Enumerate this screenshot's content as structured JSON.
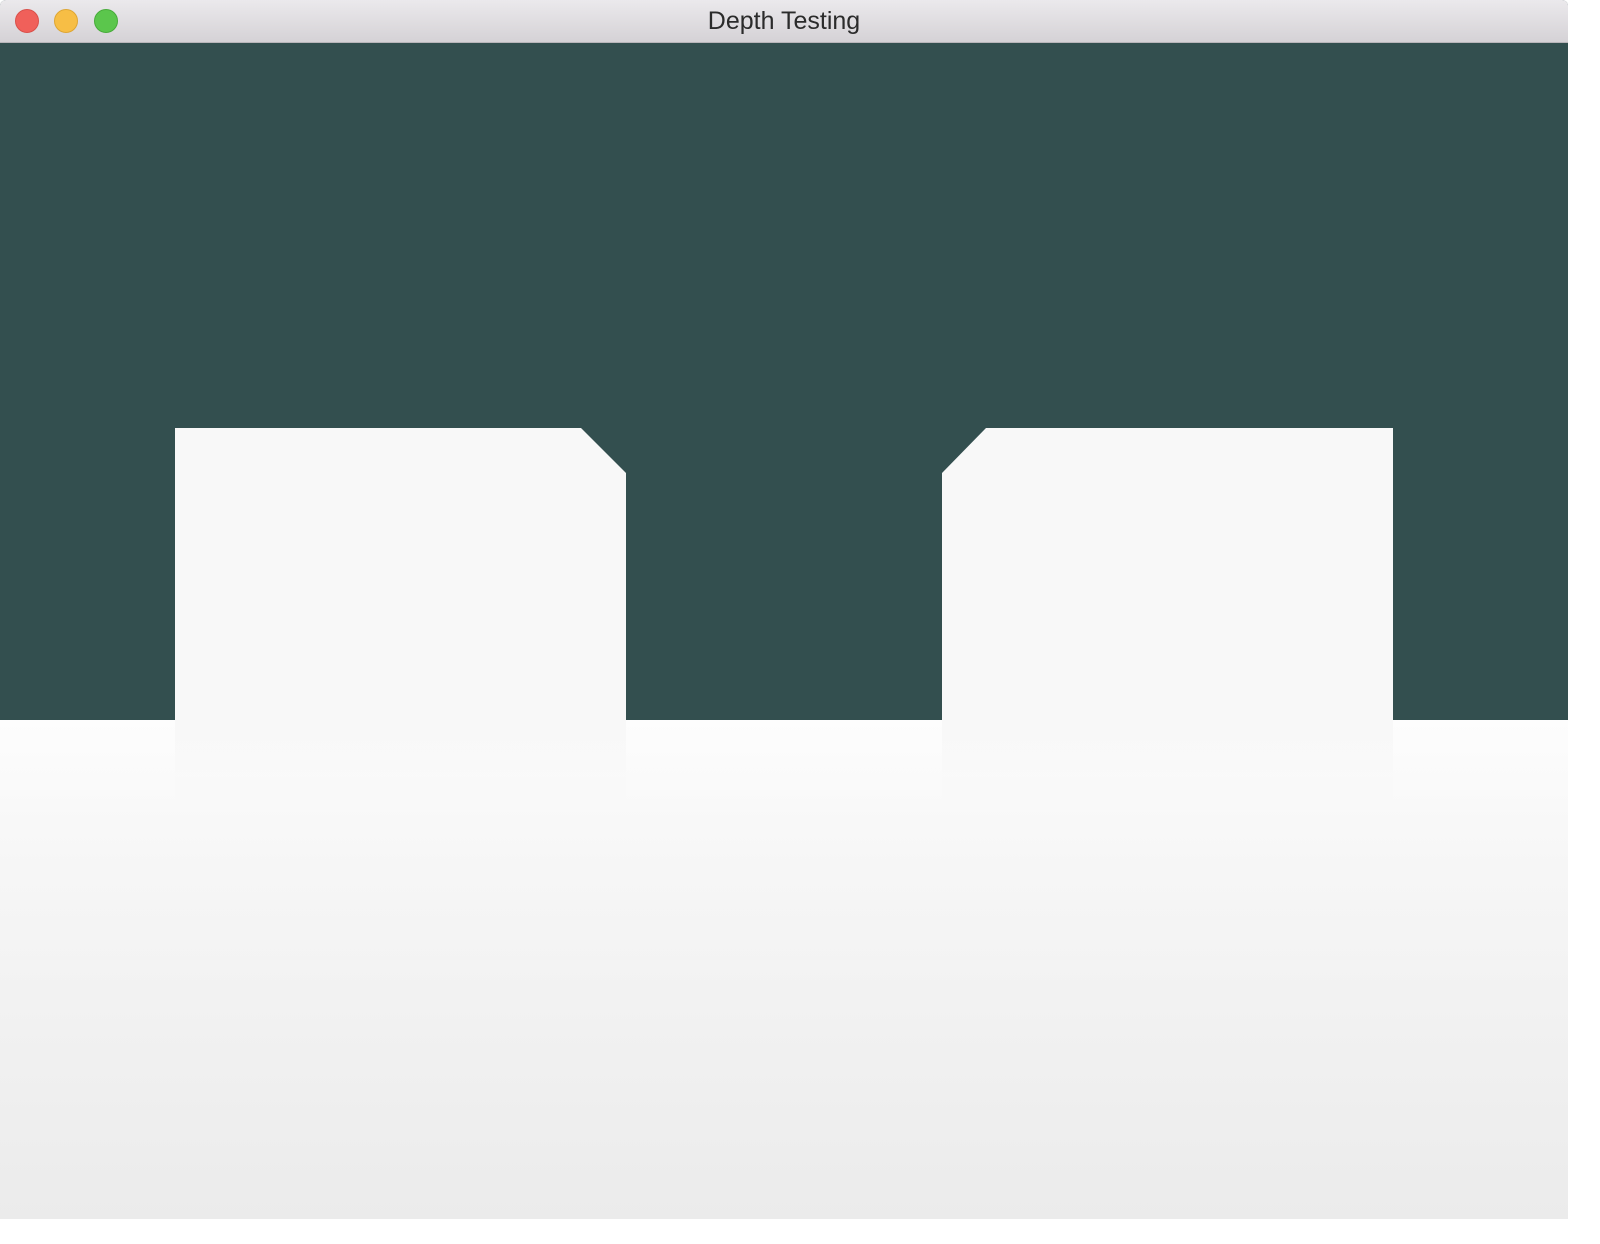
{
  "window": {
    "title": "Depth Testing",
    "clear_color": "#334f4f"
  },
  "titlebar": {
    "buttons": [
      {
        "name": "close-button",
        "color": "#f0605a"
      },
      {
        "name": "minimize-button",
        "color": "#f7be45"
      },
      {
        "name": "zoom-button",
        "color": "#5bc64c"
      }
    ]
  },
  "scene": {
    "objects": [
      "floor-plane",
      "cube-left",
      "cube-right"
    ],
    "floor_color": "#f6f6f6",
    "cube_color": "#f8f8f8"
  }
}
